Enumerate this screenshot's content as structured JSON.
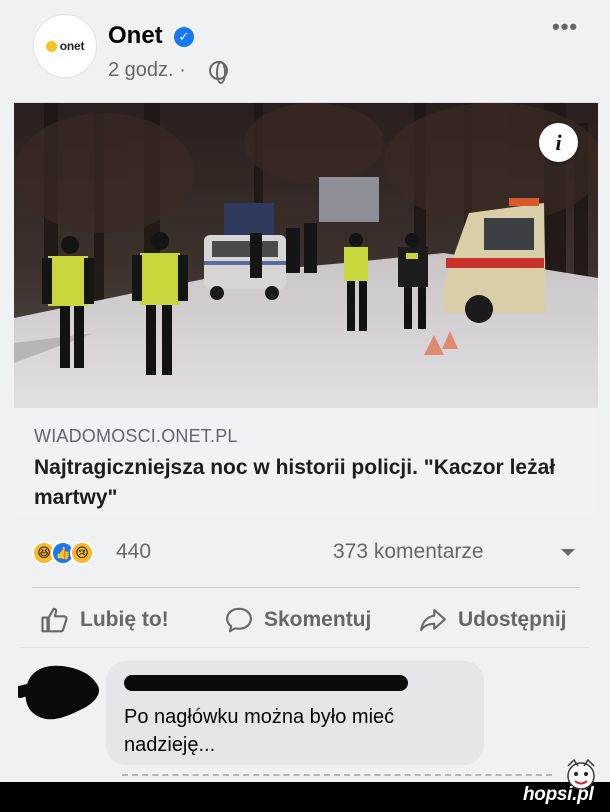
{
  "post": {
    "page_name": "Onet",
    "avatar_text": "onet",
    "time_ago": "2 godz. · ",
    "verified_mark": "✓",
    "more_label": "•••"
  },
  "link_card": {
    "domain": "WIADOMOSCI.ONET.PL",
    "title": "Najtragiczniejsza noc w historii policji. \"Kaczor leżał martwy\"",
    "info_label": "i"
  },
  "reactions": {
    "count": "440",
    "comments": "373 komentarze",
    "types": [
      "haha",
      "like",
      "sad"
    ]
  },
  "actions": {
    "like_label": "Lubię to!",
    "comment_label": "Skomentuj",
    "share_label": "Udostępnij"
  },
  "comment": {
    "text": "Po nagłówku można było mieć nadzieję..."
  },
  "watermark": {
    "text": "hopsi.pl"
  },
  "colors": {
    "facebook_blue": "#1877f2",
    "reaction_yellow": "#f7b928",
    "secondary_text": "#65676b",
    "onet_yellow": "#f6c325"
  }
}
